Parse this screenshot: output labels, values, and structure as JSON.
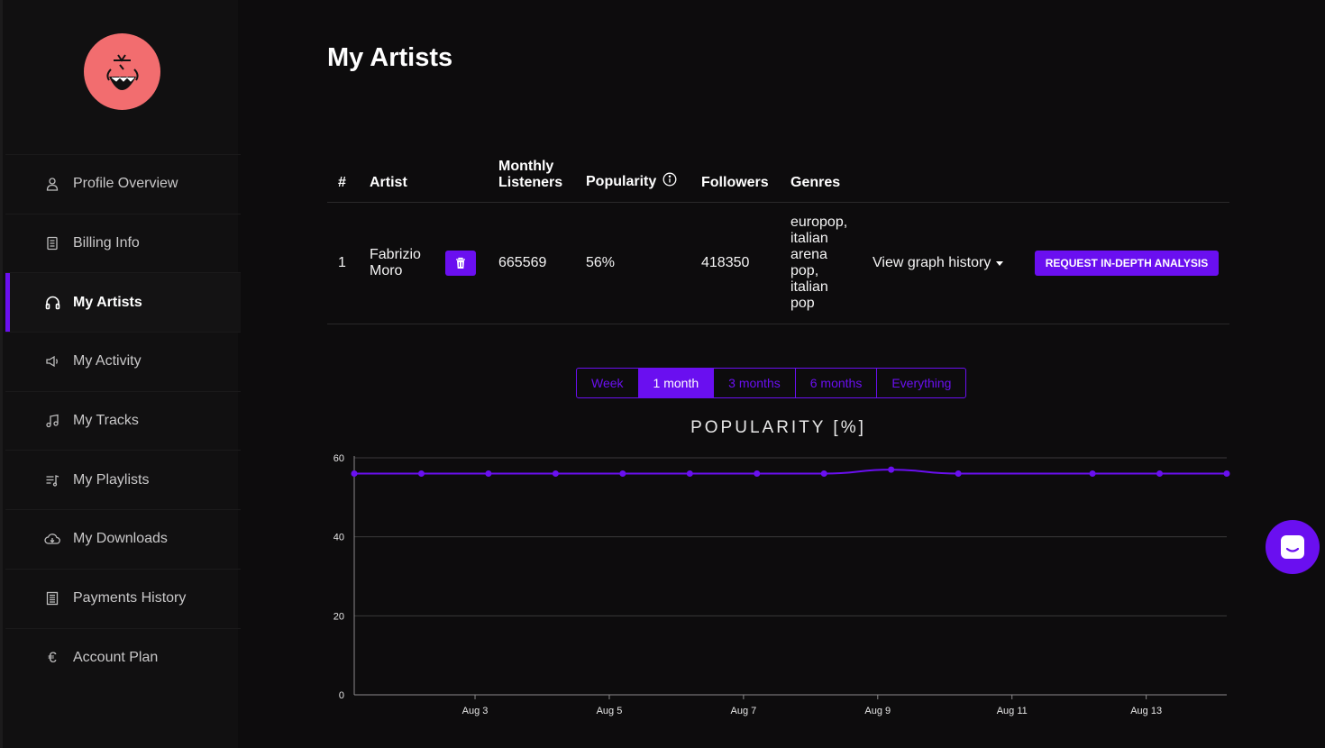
{
  "sidebar": {
    "items": [
      {
        "label": "Profile Overview",
        "icon": "user-icon"
      },
      {
        "label": "Billing Info",
        "icon": "receipt-icon"
      },
      {
        "label": "My Artists",
        "icon": "headphones-icon",
        "active": true
      },
      {
        "label": "My Activity",
        "icon": "megaphone-icon"
      },
      {
        "label": "My Tracks",
        "icon": "music-note-icon"
      },
      {
        "label": "My Playlists",
        "icon": "playlist-icon"
      },
      {
        "label": "My Downloads",
        "icon": "cloud-download-icon"
      },
      {
        "label": "Payments History",
        "icon": "document-list-icon"
      },
      {
        "label": "Account Plan",
        "icon": "euro-icon"
      }
    ]
  },
  "main": {
    "title": "My Artists",
    "table": {
      "headers": {
        "num": "#",
        "artist": "Artist",
        "monthly_1": "Monthly",
        "monthly_2": "Listeners",
        "popularity": "Popularity",
        "followers": "Followers",
        "genres": "Genres"
      },
      "rows": [
        {
          "num": "1",
          "artist_1": "Fabrizio",
          "artist_2": "Moro",
          "monthly_listeners": "665569",
          "popularity": "56%",
          "followers": "418350",
          "genres_lines": [
            "europop,",
            "italian",
            "arena",
            "pop,",
            "italian",
            "pop"
          ],
          "graph_label": "View graph history",
          "request_label": "REQUEST IN-DEPTH ANALYSIS"
        }
      ]
    },
    "ranges": [
      {
        "label": "Week"
      },
      {
        "label": "1 month",
        "active": true
      },
      {
        "label": "3 months"
      },
      {
        "label": "6 months"
      },
      {
        "label": "Everything"
      }
    ]
  },
  "colors": {
    "accent": "#6a0ff0",
    "avatar": "#f26d6f",
    "background": "#0d0c0d",
    "sidebar": "#111011"
  },
  "chart_data": {
    "type": "line",
    "title": "POPULARITY [%]",
    "ylim": [
      0,
      60
    ],
    "yticks": [
      0,
      20,
      40,
      60
    ],
    "xtick_labels": [
      "Aug 3",
      "Aug 5",
      "Aug 7",
      "Aug 9",
      "Aug 11",
      "Aug 13"
    ],
    "xtick_days": [
      3,
      5,
      7,
      9,
      11,
      13
    ],
    "xlim": [
      1.2,
      14.2
    ],
    "grid": true,
    "series": [
      {
        "x": [
          1.2,
          2.2,
          3.2,
          4.2,
          5.2,
          6.2,
          7.2,
          8.2,
          9.2,
          10.2,
          12.2,
          13.2,
          14.2
        ],
        "values": [
          56,
          56,
          56,
          56,
          56,
          56,
          56,
          56,
          57,
          56,
          56,
          56,
          56
        ]
      }
    ]
  }
}
